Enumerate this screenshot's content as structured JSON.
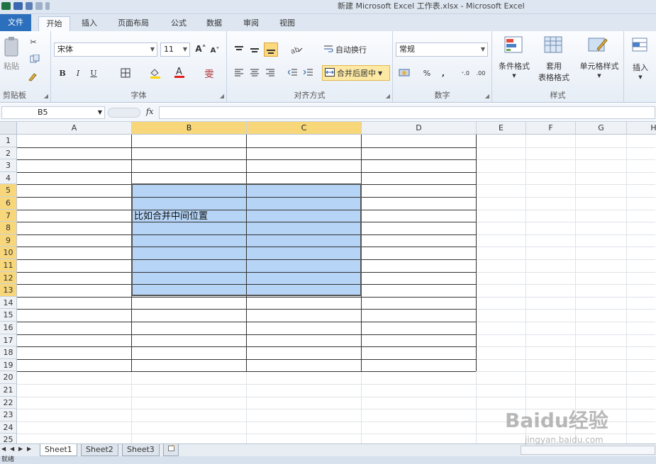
{
  "window": {
    "title": "新建 Microsoft Excel 工作表.xlsx - Microsoft Excel"
  },
  "tabs": {
    "file": "文件",
    "home": "开始",
    "insert": "插入",
    "layout": "页面布局",
    "formulas": "公式",
    "data": "数据",
    "review": "审阅",
    "view": "视图"
  },
  "ribbon": {
    "clipboard": {
      "paste": "粘贴",
      "label": "剪贴板"
    },
    "font": {
      "name": "宋体",
      "size": "11",
      "bold": "B",
      "italic": "I",
      "underline": "U",
      "label": "字体"
    },
    "alignment": {
      "wrap_text": "自动换行",
      "merge_center": "合并后居中",
      "label": "对齐方式"
    },
    "number": {
      "format": "常规",
      "percent": "%",
      "comma": ",",
      "label": "数字"
    },
    "styles": {
      "conditional": "条件格式",
      "format_table_1": "套用",
      "format_table_2": "表格格式",
      "cell_styles": "单元格样式",
      "label": "样式"
    },
    "cells": {
      "insert": "插入"
    }
  },
  "formula_bar": {
    "name_box": "B5",
    "fx": "fx",
    "value": ""
  },
  "grid": {
    "columns": [
      "A",
      "B",
      "C",
      "D",
      "E",
      "F",
      "G",
      "H"
    ],
    "selected_columns": [
      "B",
      "C"
    ],
    "rows": [
      "1",
      "2",
      "3",
      "4",
      "5",
      "6",
      "7",
      "8",
      "9",
      "10",
      "11",
      "12",
      "13",
      "14",
      "15",
      "16",
      "17",
      "18",
      "19",
      "20",
      "21",
      "22",
      "23",
      "24",
      "25"
    ],
    "selected_rows": [
      "5",
      "6",
      "7",
      "8",
      "9",
      "10",
      "11",
      "12",
      "13"
    ],
    "selection_range": "B5:C13",
    "selection_color": "#b5d4f6",
    "bordered_range": "A1:D19",
    "cells": {
      "B7": "比如合并中间位置"
    }
  },
  "sheets": [
    "Sheet1",
    "Sheet2",
    "Sheet3"
  ],
  "active_sheet": "Sheet1",
  "status": {
    "text": "就绪"
  },
  "watermark": {
    "main": "Baidu经验",
    "sub": "jingyan.baidu.com"
  }
}
